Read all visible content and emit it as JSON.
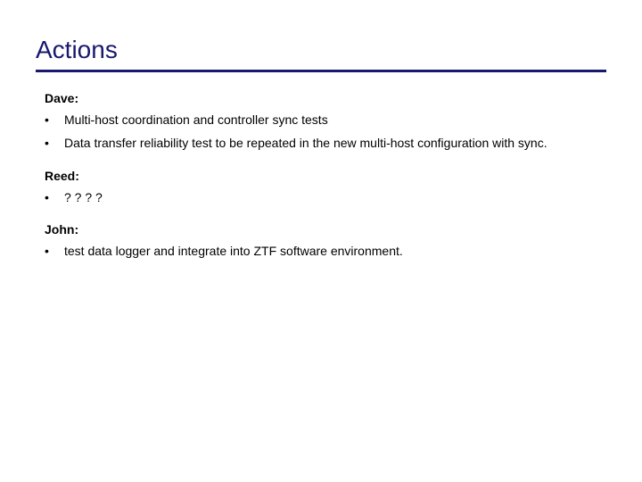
{
  "title": "Actions",
  "sections": [
    {
      "heading": "Dave:",
      "items": [
        "Multi-host coordination and controller sync tests",
        "Data transfer reliability test to be repeated in the new multi-host configuration with sync."
      ]
    },
    {
      "heading": "Reed:",
      "items": [
        "? ? ? ?"
      ]
    },
    {
      "heading": "John:",
      "items": [
        "test data logger and integrate into ZTF software environment."
      ]
    }
  ]
}
